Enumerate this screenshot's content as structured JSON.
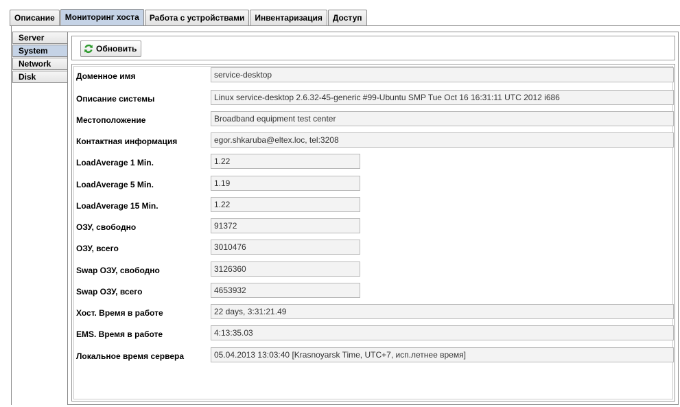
{
  "top_tabs": [
    {
      "label": "Описание",
      "active": false
    },
    {
      "label": "Мониторинг хоста",
      "active": true
    },
    {
      "label": "Работа с устройствами",
      "active": false
    },
    {
      "label": "Инвентаризация",
      "active": false
    },
    {
      "label": "Доступ",
      "active": false
    }
  ],
  "side_tabs": [
    {
      "label": "Server",
      "active": false
    },
    {
      "label": "System",
      "active": true
    },
    {
      "label": "Network",
      "active": false
    },
    {
      "label": "Disk",
      "active": false
    }
  ],
  "toolbar": {
    "refresh_label": "Обновить",
    "refresh_icon": "refresh-icon"
  },
  "fields": [
    {
      "label": "Доменное имя",
      "value": "service-desktop"
    },
    {
      "label": "Описание системы",
      "value": "Linux service-desktop 2.6.32-45-generic #99-Ubuntu SMP Tue Oct 16 16:31:11 UTC 2012 i686"
    },
    {
      "label": "Местоположение",
      "value": "Broadband equipment test center"
    },
    {
      "label": "Контактная информация",
      "value": "egor.shkaruba@eltex.loc, tel:3208"
    },
    {
      "label": "LoadAverage 1 Min.",
      "value": "1.22"
    },
    {
      "label": "LoadAverage 5 Min.",
      "value": "1.19"
    },
    {
      "label": "LoadAverage 15 Min.",
      "value": "1.22"
    },
    {
      "label": "ОЗУ, свободно",
      "value": "91372"
    },
    {
      "label": "ОЗУ, всего",
      "value": "3010476"
    },
    {
      "label": "Swap ОЗУ, свободно",
      "value": "3126360"
    },
    {
      "label": "Swap ОЗУ, всего",
      "value": "4653932"
    },
    {
      "label": "Хост. Время в работе",
      "value": "22 days, 3:31:21.49"
    },
    {
      "label": "EMS. Время в работе",
      "value": "4:13:35.03"
    },
    {
      "label": "Локальное время сервера",
      "value": "05.04.2013 13:03:40 [Krasnoyarsk Time, UTC+7, исп.летнее время]"
    }
  ],
  "colors": {
    "active_tab": "#c5d3e6",
    "field_bg": "#f3f3f3",
    "border": "#8a8a8a"
  }
}
